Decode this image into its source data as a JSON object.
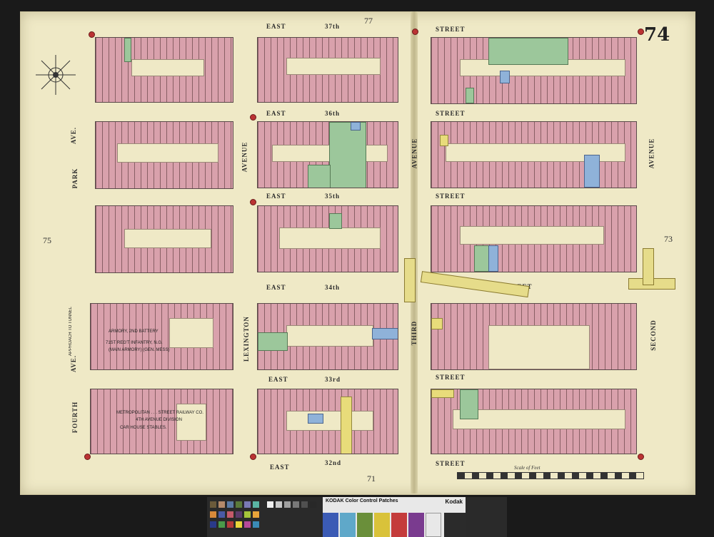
{
  "map": {
    "plate_number": "74",
    "adjacent_plates": {
      "top": "77",
      "left": "75",
      "right": "73",
      "bottom": "71"
    },
    "streets": {
      "e37": {
        "prefix": "EAST",
        "name": "37th",
        "suffix": "STREET"
      },
      "e36": {
        "prefix": "EAST",
        "name": "36th",
        "suffix": "STREET"
      },
      "e35": {
        "prefix": "EAST",
        "name": "35th",
        "suffix": "STREET"
      },
      "e34": {
        "prefix": "EAST",
        "name": "34th",
        "suffix": "STREET"
      },
      "e33": {
        "prefix": "EAST",
        "name": "33rd",
        "suffix": "STREET"
      },
      "e32": {
        "prefix": "EAST",
        "name": "32nd",
        "suffix": "STREET"
      }
    },
    "avenues": {
      "park": "PARK",
      "park_ave": "AVE.",
      "fourth": "FOURTH",
      "fourth_ave": "AVE.",
      "lexington": "LEXINGTON",
      "lex_avenue": "AVENUE",
      "third": "THIRD",
      "third_avenue": "AVENUE",
      "second": "SECOND",
      "second_avenue": "AVENUE"
    },
    "buildings": {
      "armory1": "ARMORY, 2nd BATTERY",
      "armory2": "71st REG'T INFANTRY, N.G.",
      "armory3": "(Main Armory) (Gen. Mess)",
      "approach": "APPROACH TO TUNNEL",
      "metro1": "METROPOLITAN . . . STREET RAILWAY CO.",
      "metro2": "4th AVENUE DIVISION",
      "metro3": "CAR HOUSE STABLES."
    },
    "scale_label": "Scale of Feet",
    "colors": {
      "brick": "#d9a1ac",
      "frame": "#e8dc7a",
      "stone": "#9cc79b",
      "fireproof": "#8fb2d9",
      "paper": "#efe9c6"
    }
  },
  "target": {
    "kodak_title": "KODAK Color Control Patches",
    "kodak_brand": "Kodak",
    "patches": [
      "#3b5bb5",
      "#5fa8c9",
      "#6a8f3a",
      "#d9c23a",
      "#c43b3b",
      "#7a3b8f",
      "#e8e8e8",
      "#2b2b2b"
    ]
  }
}
